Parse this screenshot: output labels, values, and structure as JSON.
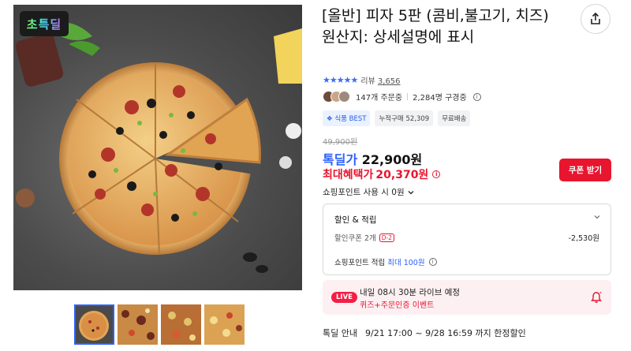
{
  "product": {
    "badge": "초특딜",
    "title": "[올반] 피자 5판 (콤비,불고기, 치즈)",
    "origin": "원산지: 상세설명에 표시",
    "rating_stars": "★★★★★",
    "review_label": "리뷰",
    "review_count": "3,656",
    "orders": "147개 주문중",
    "interested": "2,284명 구경중",
    "tags": [
      "식품 BEST",
      "누적구매 52,309",
      "무료배송"
    ],
    "original_price": "49,900원",
    "deal_label": "톡딜가",
    "deal_price": "22,900원",
    "max_label": "최대혜택가",
    "max_price": "20,370원",
    "coupon_button": "쿠폰 받기",
    "points_use": "쇼핑포인트 사용 시 0원"
  },
  "benefits": {
    "title": "할인 & 적립",
    "coupon_label": "할인쿠폰 2개",
    "coupon_dday": "D-2",
    "coupon_amount": "-2,530원",
    "points_prefix": "쇼핑포인트 적립",
    "points_highlight": "최대 100원"
  },
  "live": {
    "badge": "LIVE",
    "schedule": "내일 08시 30분 라이브 예정",
    "event": "퀴즈+주문인증 이벤트"
  },
  "deal_info": {
    "label": "톡딜 안내",
    "period": "9/21 17:00 ~ 9/28 16:59 까지 한정할인"
  },
  "colors": {
    "accent_blue": "#2b61ff",
    "accent_red": "#e8152f"
  },
  "icons": {
    "share": "share-icon",
    "bell": "bell-icon",
    "info": "info-icon",
    "chevron": "chevron-down-icon"
  }
}
